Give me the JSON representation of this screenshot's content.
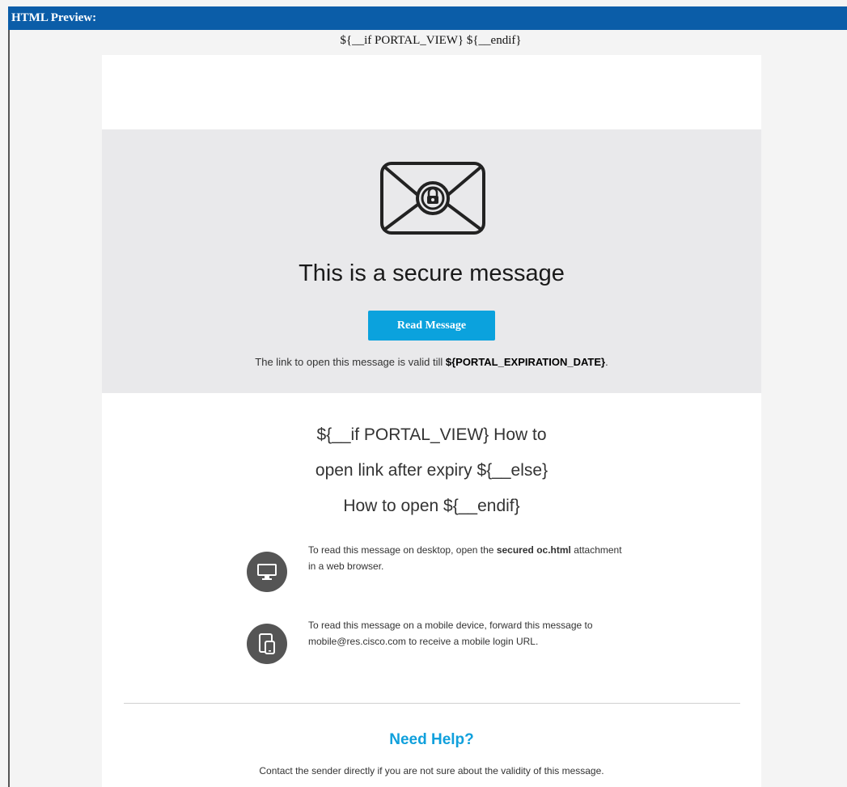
{
  "window": {
    "title": "HTML Preview:"
  },
  "template": {
    "portal_if": "${__if PORTAL_VIEW} ${__endif}"
  },
  "hero": {
    "title": "This is a secure message",
    "button_label": "Read Message",
    "validity_prefix": "The link to open this message is valid till ",
    "validity_var": "${PORTAL_EXPIRATION_DATE}",
    "validity_suffix": "."
  },
  "howto": {
    "lines": [
      "${__if PORTAL_VIEW} How to",
      "open link after expiry ${__else}",
      "How to open ${__endif}"
    ]
  },
  "tips": {
    "desktop": {
      "prefix": "To read this message on desktop, open the ",
      "bold": "secured oc.html",
      "suffix": " attachment in a web browser.",
      "icon": "desktop-icon"
    },
    "mobile": {
      "text": "To read this message on a mobile device, forward this message to mobile@res.cisco.com to receive a mobile login URL.",
      "icon": "mobile-icon"
    }
  },
  "help": {
    "title": "Need Help?",
    "text": "Contact the sender directly if you are not sure about the validity of this message."
  },
  "colors": {
    "titlebar": "#0b5da8",
    "button": "#0ba2dd",
    "help_title": "#10a0dc",
    "hero_bg": "#e9e9eb",
    "icon_circle": "#555555"
  }
}
